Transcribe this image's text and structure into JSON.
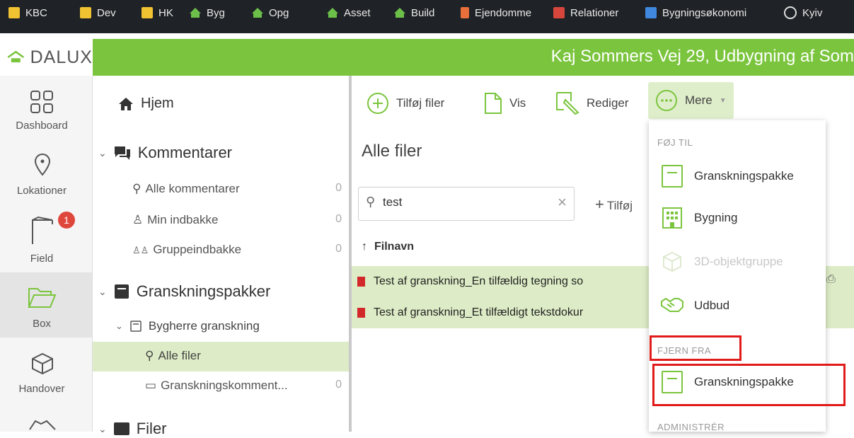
{
  "bookmarks": [
    {
      "label": "KBC",
      "icon": "folder-icon"
    },
    {
      "label": "Dev",
      "icon": "folder-icon"
    },
    {
      "label": "HK",
      "icon": "folder-icon"
    },
    {
      "label": "Byg",
      "icon": "house-icon"
    },
    {
      "label": "Opg",
      "icon": "house-icon"
    },
    {
      "label": "Asset",
      "icon": "house-icon"
    },
    {
      "label": "Build",
      "icon": "house-icon"
    },
    {
      "label": "Ejendomme",
      "icon": "property-icon"
    },
    {
      "label": "Relationer",
      "icon": "relations-icon"
    },
    {
      "label": "Bygningsøkonomi",
      "icon": "spreadsheet-icon"
    },
    {
      "label": "Kyiv",
      "icon": "globe-icon"
    }
  ],
  "header": {
    "logo": "DALUX",
    "title": "Kaj Sommers Vej 29, Udbygning af Som",
    "color": "#7bc53e"
  },
  "rail": [
    {
      "label": "Dashboard",
      "icon": "dashboard-icon"
    },
    {
      "label": "Lokationer",
      "icon": "location-pin-icon"
    },
    {
      "label": "Field",
      "icon": "crane-icon",
      "badge": "1"
    },
    {
      "label": "Box",
      "icon": "folder-open-icon",
      "active": true
    },
    {
      "label": "Handover",
      "icon": "box-icon"
    }
  ],
  "tree": {
    "home": "Hjem",
    "comments": "Kommentarer",
    "all_comments": "Alle kommentarer",
    "all_comments_count": "0",
    "my_inbox": "Min indbakke",
    "my_inbox_count": "0",
    "group_inbox": "Gruppeindbakke",
    "group_inbox_count": "0",
    "review_packages": "Granskningspakker",
    "client_review": "Bygherre granskning",
    "all_files": "Alle filer",
    "review_comments": "Granskningskomment...",
    "review_comments_count": "0",
    "files": "Filer"
  },
  "toolbar": {
    "add_files": "Tilføj filer",
    "view": "Vis",
    "edit": "Rediger",
    "more": "Mere"
  },
  "main": {
    "heading": "Alle filer",
    "search_value": "test",
    "add_label": "Tilføj",
    "column_filename": "Filnavn",
    "files": [
      "Test af granskning_En tilfældig tegning so",
      "Test af granskning_Et tilfældigt tekstdokur"
    ]
  },
  "dropdown": {
    "add_to_header": "FØJ TIL",
    "add_items": [
      {
        "label": "Granskningspakke",
        "icon": "review-package-icon",
        "disabled": false
      },
      {
        "label": "Bygning",
        "icon": "building-icon",
        "disabled": false
      },
      {
        "label": "3D-objektgruppe",
        "icon": "cube-icon",
        "disabled": true
      },
      {
        "label": "Udbud",
        "icon": "handshake-icon",
        "disabled": false
      }
    ],
    "remove_from_header": "FJERN FRA",
    "remove_items": [
      {
        "label": "Granskningspakke",
        "icon": "review-package-icon"
      }
    ],
    "manage_header": "ADMINISTRÉR",
    "highlight_color": "#e11a1a"
  }
}
